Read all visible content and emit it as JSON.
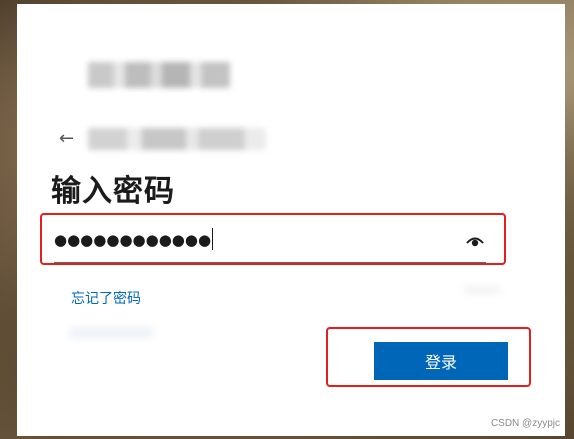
{
  "signin": {
    "title": "输入密码",
    "back_arrow": "←",
    "password_value": "●●●●●●●●●●●●",
    "forgot_password_label": "忘记了密码",
    "submit_label": "登录"
  },
  "icons": {
    "back": "arrow-left-icon",
    "reveal_password": "eye-icon"
  },
  "colors": {
    "accent": "#0067b8",
    "highlight": "#e0201f",
    "text": "#1b1b1b"
  },
  "watermark": "CSDN @zyypjc"
}
